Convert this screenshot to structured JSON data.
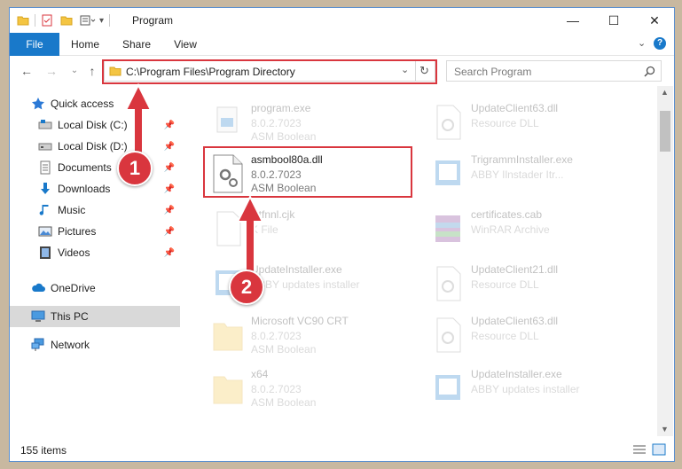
{
  "window": {
    "title": "Program",
    "minimize_glyph": "—",
    "maximize_glyph": "☐",
    "close_glyph": "✕"
  },
  "ribbon": {
    "tabs": [
      {
        "label": "File"
      },
      {
        "label": "Home"
      },
      {
        "label": "Share"
      },
      {
        "label": "View"
      }
    ]
  },
  "navigation": {
    "address": "C:\\Program Files\\Program Directory",
    "search_placeholder": "Search Program"
  },
  "sidebar": {
    "items": [
      {
        "label": "Quick access",
        "icon": "star-icon",
        "pinned": false
      },
      {
        "label": "Local Disk (C:)",
        "icon": "drive-icon",
        "pinned": true
      },
      {
        "label": "Local Disk (D:)",
        "icon": "drive-icon",
        "pinned": true
      },
      {
        "label": "Documents",
        "icon": "documents-icon",
        "pinned": true
      },
      {
        "label": "Downloads",
        "icon": "downloads-icon",
        "pinned": true
      },
      {
        "label": "Music",
        "icon": "music-icon",
        "pinned": true
      },
      {
        "label": "Pictures",
        "icon": "pictures-icon",
        "pinned": true
      },
      {
        "label": "Videos",
        "icon": "videos-icon",
        "pinned": true
      },
      {
        "label": "OneDrive",
        "icon": "cloud-icon",
        "pinned": false
      },
      {
        "label": "This PC",
        "icon": "computer-icon",
        "pinned": false,
        "selected": true
      },
      {
        "label": "Network",
        "icon": "network-icon",
        "pinned": false
      }
    ]
  },
  "files": [
    {
      "name": "program.exe",
      "line2": "8.0.2.7023",
      "line3": "ASM Boolean",
      "icon": "exe-icon",
      "faded": true
    },
    {
      "name": "UpdateClient63.dll",
      "line2": "Resource DLL",
      "line3": "",
      "icon": "dll-icon",
      "faded": true
    },
    {
      "name": "asmbool80a.dll",
      "line2": "8.0.2.7023",
      "line3": "ASM Boolean",
      "icon": "dll-icon",
      "faded": false,
      "highlighted": true
    },
    {
      "name": "TrigrammInstaller.exe",
      "line2": "ABBY Ilnstader Itr...",
      "line3": "",
      "icon": "installer-icon",
      "faded": true
    },
    {
      "name": "sitfnnl.cjk",
      "line2": "K File",
      "line3": "",
      "icon": "file-icon",
      "faded": true
    },
    {
      "name": "certificates.cab",
      "line2": "WinRAR Archive",
      "line3": "",
      "icon": "archive-icon",
      "faded": true
    },
    {
      "name": "UpdateInstaller.exe",
      "line2": "ABBY updates installer",
      "line3": "",
      "icon": "installer-icon",
      "faded": true
    },
    {
      "name": "UpdateClient21.dll",
      "line2": "Resource DLL",
      "line3": "",
      "icon": "dll-icon",
      "faded": true
    },
    {
      "name": "Microsoft VC90 CRT",
      "line2": "8.0.2.7023",
      "line3": "ASM Boolean",
      "icon": "folder-icon",
      "faded": true
    },
    {
      "name": "UpdateClient63.dll",
      "line2": "Resource DLL",
      "line3": "",
      "icon": "dll-icon",
      "faded": true
    },
    {
      "name": "x64",
      "line2": "8.0.2.7023",
      "line3": "ASM Boolean",
      "icon": "folder-icon",
      "faded": true
    },
    {
      "name": "UpdateInstaller.exe",
      "line2": "ABBY updates installer",
      "line3": "",
      "icon": "installer-icon",
      "faded": true
    }
  ],
  "status": {
    "item_count": "155 items"
  },
  "callouts": [
    {
      "number": "1"
    },
    {
      "number": "2"
    }
  ],
  "colors": {
    "accent": "#1979ca",
    "highlight_box": "#d9363e"
  }
}
